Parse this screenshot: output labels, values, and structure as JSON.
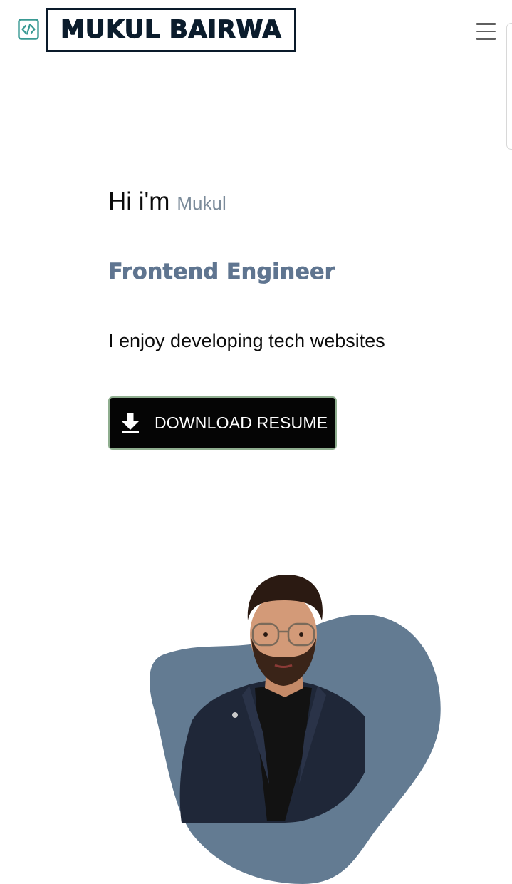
{
  "header": {
    "brand_name": "MUKUL BAIRWA",
    "logo_icon": "code-icon",
    "menu_icon": "hamburger-menu-icon"
  },
  "hero": {
    "greeting_prefix": "Hi i'm",
    "greeting_name": "Mukul",
    "role": "Frontend Engineer",
    "tagline": "I enjoy developing tech websites",
    "download_button_label": "DOWNLOAD RESUME",
    "download_icon": "download-icon"
  },
  "colors": {
    "brand_dark": "#0b1c2c",
    "accent_slate": "#5f7590",
    "blob": "#637b92",
    "icon_teal": "#3a9a94",
    "button_bg": "#050505",
    "button_border": "#8fae8f"
  }
}
